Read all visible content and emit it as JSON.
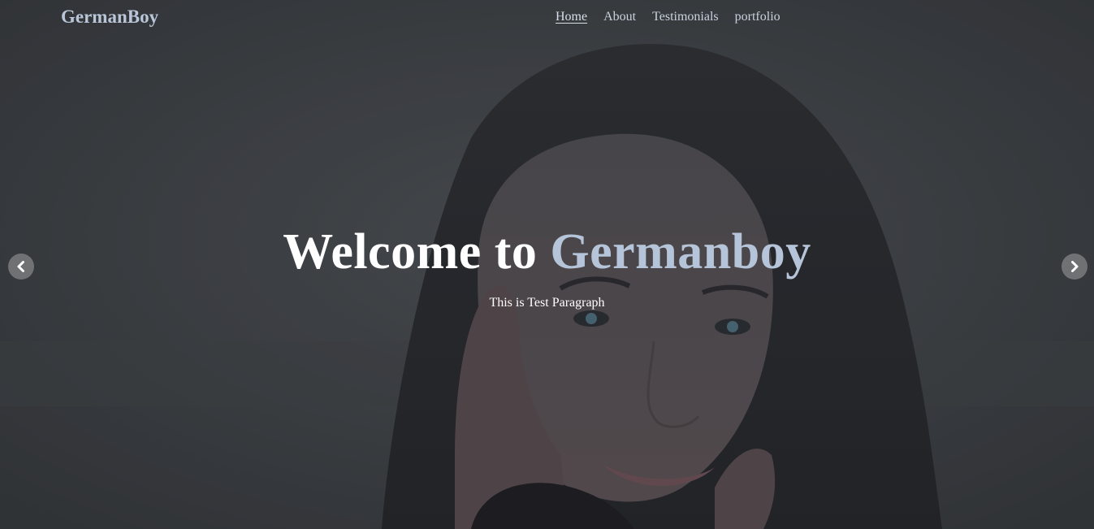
{
  "navbar": {
    "brand": "GermanBoy",
    "links": [
      {
        "label": "Home",
        "active": true
      },
      {
        "label": "About",
        "active": false
      },
      {
        "label": "Testimonials",
        "active": false
      },
      {
        "label": "portfolio",
        "active": false
      }
    ]
  },
  "hero": {
    "headline_prefix": "Welcome to",
    "headline_accent": "Germanboy",
    "paragraph": "This is Test Paragraph",
    "prev_icon": "chevron-left-icon",
    "next_icon": "chevron-right-icon"
  },
  "colors": {
    "brand": "#b9c6d8",
    "accent": "#b5c4d8",
    "text": "#ffffff",
    "overlay": "#3a3d42"
  }
}
